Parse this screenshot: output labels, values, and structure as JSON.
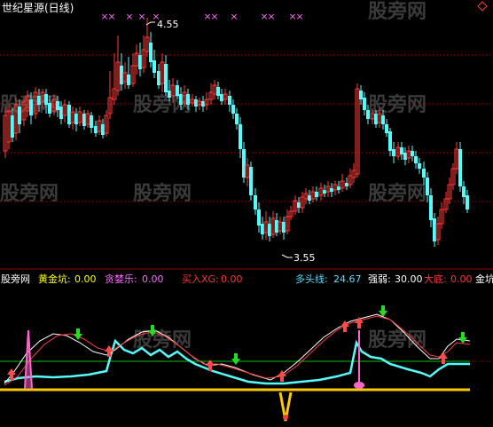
{
  "title": "世纪星源(日线)",
  "diamond_icon": "diamond-icon",
  "watermark": "股旁网",
  "main_chart": {
    "high_label": "4.55",
    "low_label": "3.55",
    "x_marker": "×"
  },
  "indicator_bar": {
    "source": "股旁网",
    "items": [
      {
        "label": "黄金坑:",
        "value": "0.00",
        "color": "#ffff00"
      },
      {
        "label": "贪婪乐:",
        "value": "0.00",
        "color": "#ff66ff"
      },
      {
        "label": "买入XG:",
        "value": "0.00",
        "color": "#ff3333"
      },
      {
        "label": "多头线:",
        "value": "24.67",
        "color": "#55ddff"
      },
      {
        "label": "强弱:",
        "value": "30.00",
        "color": "#ffffff"
      },
      {
        "label": "大底:",
        "value": "0.00",
        "color": "#ff3333"
      },
      {
        "label": "金坑",
        "value": "",
        "color": "#ffffff"
      }
    ]
  },
  "colors": {
    "up": "#ff3a3a",
    "down": "#54fcfc",
    "grid": "#8b0000",
    "cyan_line": "#54fcfc",
    "white_line": "#ffffff",
    "red_line": "#ff3a3a",
    "green_line": "#00c000",
    "yellow_line": "#ffc800",
    "magenta": "#ff66cc"
  }
}
